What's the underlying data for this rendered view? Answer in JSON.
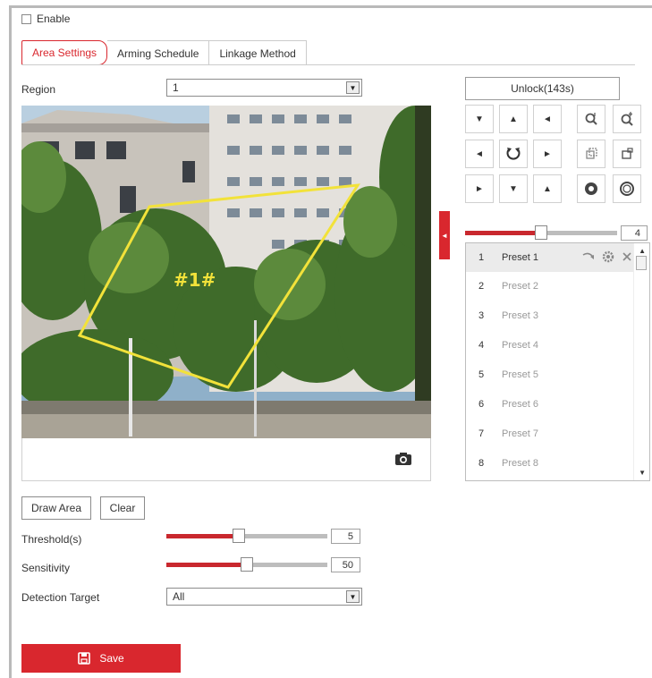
{
  "enable": {
    "label": "Enable",
    "checked": false
  },
  "tabs": [
    {
      "label": "Area Settings",
      "active": true
    },
    {
      "label": "Arming Schedule",
      "active": false
    },
    {
      "label": "Linkage Method",
      "active": false
    }
  ],
  "region": {
    "label": "Region",
    "value": "1"
  },
  "video": {
    "area_label": "#1#"
  },
  "ptz": {
    "unlock_label": "Unlock(143s)",
    "speed": {
      "value": "4",
      "fraction": 0.5
    },
    "buttons": [
      "pan-up-left",
      "pan-up",
      "pan-up-right",
      "zoom-in",
      "zoom-out",
      "pan-left",
      "auto-pan",
      "pan-right",
      "focus-near",
      "focus-far",
      "pan-down-left",
      "pan-down",
      "pan-down-right",
      "iris-open",
      "iris-close"
    ]
  },
  "presets": [
    {
      "num": "1",
      "name": "Preset 1",
      "active": true
    },
    {
      "num": "2",
      "name": "Preset 2",
      "active": false
    },
    {
      "num": "3",
      "name": "Preset 3",
      "active": false
    },
    {
      "num": "4",
      "name": "Preset 4",
      "active": false
    },
    {
      "num": "5",
      "name": "Preset 5",
      "active": false
    },
    {
      "num": "6",
      "name": "Preset 6",
      "active": false
    },
    {
      "num": "7",
      "name": "Preset 7",
      "active": false
    },
    {
      "num": "8",
      "name": "Preset 8",
      "active": false
    }
  ],
  "actions": {
    "draw_area": "Draw Area",
    "clear": "Clear"
  },
  "threshold": {
    "label": "Threshold(s)",
    "value": "5",
    "fraction": 0.45
  },
  "sensitivity": {
    "label": "Sensitivity",
    "value": "50",
    "fraction": 0.5
  },
  "detection_target": {
    "label": "Detection Target",
    "value": "All"
  },
  "save_label": "Save",
  "colors": {
    "accent": "#d9272e",
    "region_outline": "#f2e23a"
  }
}
